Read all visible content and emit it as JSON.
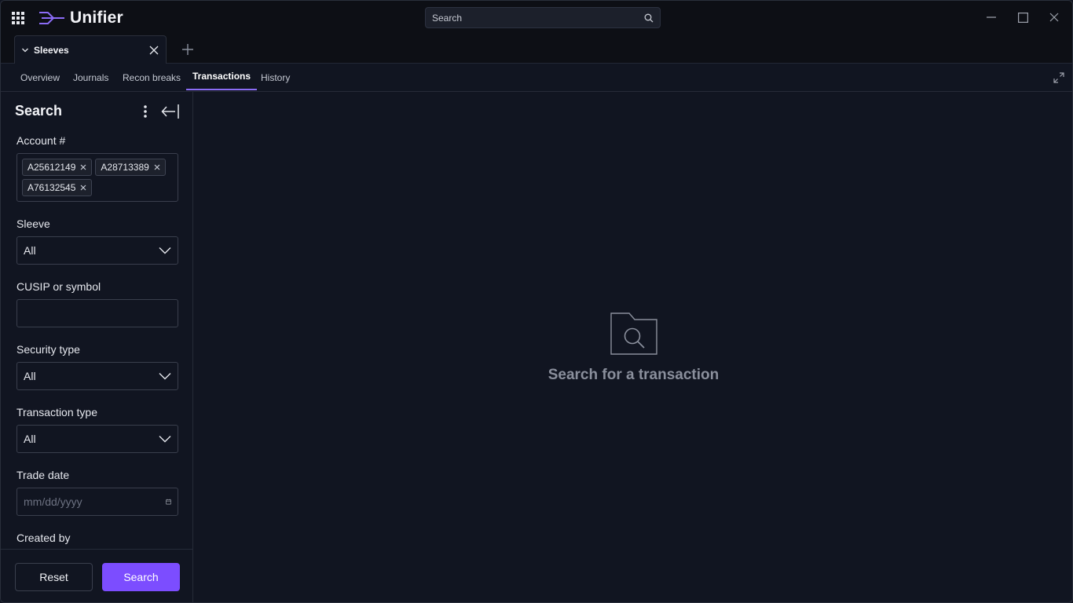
{
  "app": {
    "name": "Unifier"
  },
  "global_search": {
    "placeholder": "Search"
  },
  "doc_tab": {
    "label": "Sleeves"
  },
  "subnav": {
    "items": [
      {
        "label": "Overview"
      },
      {
        "label": "Journals"
      },
      {
        "label": "Recon breaks"
      },
      {
        "label": "Transactions"
      },
      {
        "label": "History"
      }
    ],
    "active": "Transactions"
  },
  "sidebar": {
    "title": "Search",
    "account": {
      "label": "Account #",
      "chips": [
        "A25612149",
        "A28713389",
        "A76132545"
      ]
    },
    "sleeve": {
      "label": "Sleeve",
      "value": "All"
    },
    "cusip": {
      "label": "CUSIP or symbol",
      "value": ""
    },
    "security_type": {
      "label": "Security type",
      "value": "All"
    },
    "transaction_type": {
      "label": "Transaction type",
      "value": "All"
    },
    "trade_date": {
      "label": "Trade date",
      "placeholder": "mm/dd/yyyy"
    },
    "created_by": {
      "label": "Created by",
      "value": ""
    },
    "reset_label": "Reset",
    "search_label": "Search"
  },
  "main": {
    "empty_message": "Search for a transaction"
  },
  "colors": {
    "accent": "#7c4dff",
    "tab_underline": "#8b6cf6",
    "background": "#111521",
    "titlebar": "#0d0f15"
  },
  "icons": {
    "apps": "apps-grid-icon",
    "logo": "unifier-logo-icon",
    "search": "search-icon",
    "minimize": "minimize-icon",
    "maximize": "maximize-icon",
    "close": "close-icon",
    "chevron": "chevron-down-icon",
    "add": "plus-icon",
    "expand": "expand-icon",
    "kebab": "more-vertical-icon",
    "collapse": "collapse-left-icon",
    "calendar": "calendar-icon",
    "empty": "folder-search-icon"
  }
}
